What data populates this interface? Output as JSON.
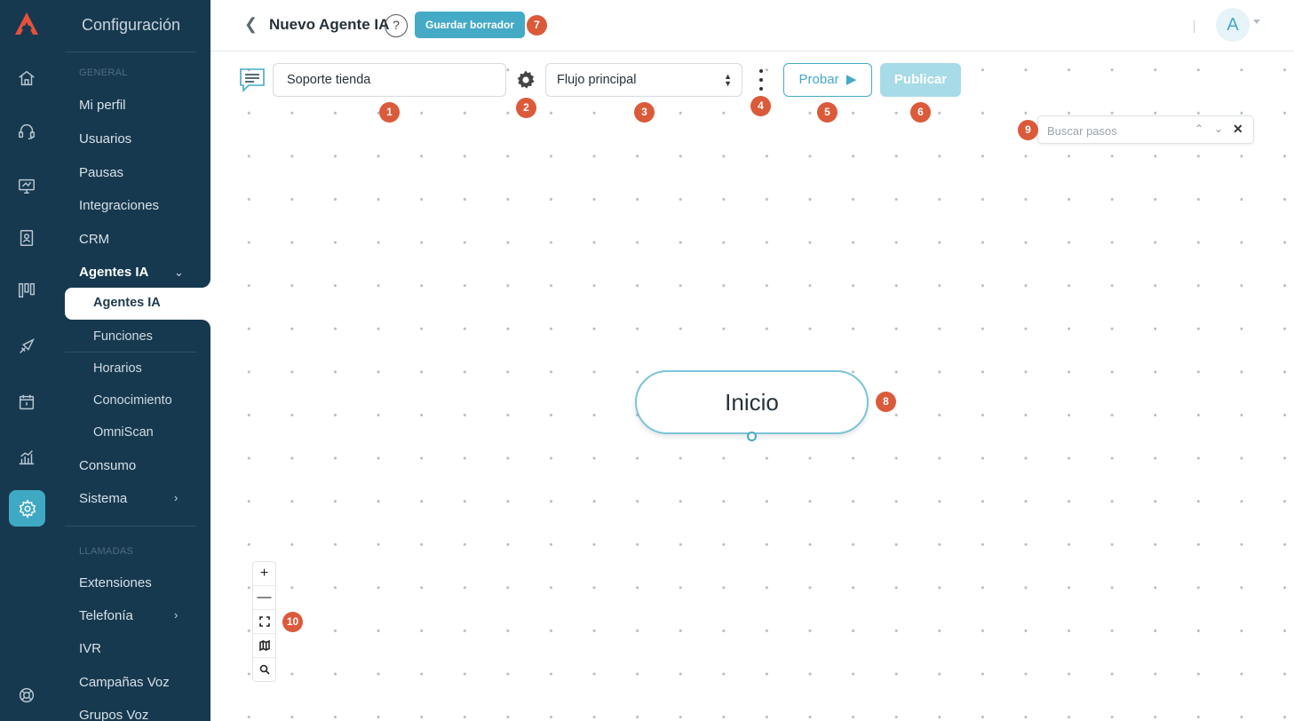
{
  "menu": {
    "title": "Configuración",
    "section_general": "GENERAL",
    "items_general": [
      {
        "label": "Mi perfil"
      },
      {
        "label": "Usuarios"
      },
      {
        "label": "Pausas"
      },
      {
        "label": "Integraciones"
      },
      {
        "label": "CRM"
      },
      {
        "label": "Agentes IA",
        "expanded": true
      }
    ],
    "sub_items": [
      {
        "label": "Agentes IA",
        "active": true
      },
      {
        "label": "Funciones"
      },
      {
        "label": "Horarios"
      },
      {
        "label": "Conocimiento"
      },
      {
        "label": "OmniScan"
      }
    ],
    "items_after": [
      {
        "label": "Consumo"
      },
      {
        "label": "Sistema",
        "has_children": true
      }
    ],
    "section_calls": "LLAMADAS",
    "items_calls": [
      {
        "label": "Extensiones"
      },
      {
        "label": "Telefonía",
        "has_children": true
      },
      {
        "label": "IVR"
      },
      {
        "label": "Campañas Voz"
      },
      {
        "label": "Grupos Voz"
      }
    ]
  },
  "rail_icons": [
    "home-icon",
    "headset-icon",
    "monitor-icon",
    "contacts-icon",
    "kanban-icon",
    "campaign-icon",
    "calendar-icon",
    "analytics-icon",
    "settings-icon",
    "help-lifebuoy-icon"
  ],
  "header": {
    "title": "Nuevo Agente IA",
    "help": "?",
    "save_draft": "Guardar borrador",
    "avatar_initial": "A"
  },
  "toolbar": {
    "agent_name": "Soporte tienda",
    "flow": "Flujo principal",
    "test_label": "Probar",
    "publish_label": "Publicar"
  },
  "search": {
    "placeholder": "Buscar pasos"
  },
  "canvas": {
    "start_node": "Inicio"
  },
  "badges": [
    "1",
    "2",
    "3",
    "4",
    "5",
    "6",
    "7",
    "8",
    "9",
    "10"
  ],
  "colors": {
    "sidebar": "#17394f",
    "accent": "#44aac6",
    "badge": "#db5a3a",
    "publish_disabled": "#a8dbe8"
  }
}
